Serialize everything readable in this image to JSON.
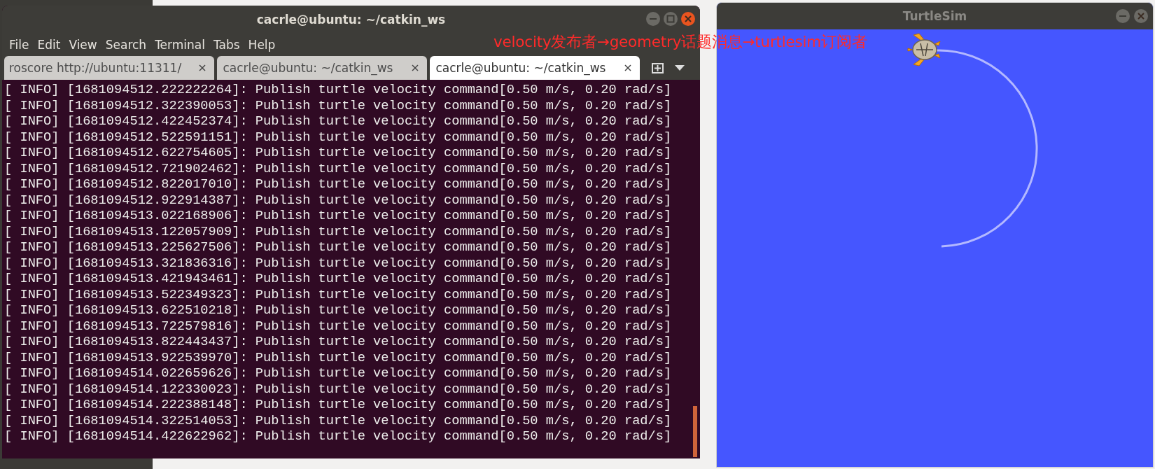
{
  "terminal": {
    "title": "cacrle@ubuntu: ~/catkin_ws",
    "controls": [
      {
        "kind": "minimize"
      },
      {
        "kind": "maximize"
      },
      {
        "kind": "close"
      }
    ],
    "menu": [
      "File",
      "Edit",
      "View",
      "Search",
      "Terminal",
      "Tabs",
      "Help"
    ],
    "tabs": [
      {
        "label": "roscore http://ubuntu:11311/",
        "selected": false
      },
      {
        "label": "cacrle@ubuntu: ~/catkin_ws",
        "selected": false
      },
      {
        "label": "cacrle@ubuntu: ~/catkin_ws",
        "selected": true
      }
    ],
    "lines": [
      "[ INFO] [1681094512.222222264]: Publish turtle velocity command[0.50 m/s, 0.20 rad/s]",
      "[ INFO] [1681094512.322390053]: Publish turtle velocity command[0.50 m/s, 0.20 rad/s]",
      "[ INFO] [1681094512.422452374]: Publish turtle velocity command[0.50 m/s, 0.20 rad/s]",
      "[ INFO] [1681094512.522591151]: Publish turtle velocity command[0.50 m/s, 0.20 rad/s]",
      "[ INFO] [1681094512.622754605]: Publish turtle velocity command[0.50 m/s, 0.20 rad/s]",
      "[ INFO] [1681094512.721902462]: Publish turtle velocity command[0.50 m/s, 0.20 rad/s]",
      "[ INFO] [1681094512.822017010]: Publish turtle velocity command[0.50 m/s, 0.20 rad/s]",
      "[ INFO] [1681094512.922914387]: Publish turtle velocity command[0.50 m/s, 0.20 rad/s]",
      "[ INFO] [1681094513.022168906]: Publish turtle velocity command[0.50 m/s, 0.20 rad/s]",
      "[ INFO] [1681094513.122057909]: Publish turtle velocity command[0.50 m/s, 0.20 rad/s]",
      "[ INFO] [1681094513.225627506]: Publish turtle velocity command[0.50 m/s, 0.20 rad/s]",
      "[ INFO] [1681094513.321836316]: Publish turtle velocity command[0.50 m/s, 0.20 rad/s]",
      "[ INFO] [1681094513.421943461]: Publish turtle velocity command[0.50 m/s, 0.20 rad/s]",
      "[ INFO] [1681094513.522349323]: Publish turtle velocity command[0.50 m/s, 0.20 rad/s]",
      "[ INFO] [1681094513.622510218]: Publish turtle velocity command[0.50 m/s, 0.20 rad/s]",
      "[ INFO] [1681094513.722579816]: Publish turtle velocity command[0.50 m/s, 0.20 rad/s]",
      "[ INFO] [1681094513.822443437]: Publish turtle velocity command[0.50 m/s, 0.20 rad/s]",
      "[ INFO] [1681094513.922539970]: Publish turtle velocity command[0.50 m/s, 0.20 rad/s]",
      "[ INFO] [1681094514.022659626]: Publish turtle velocity command[0.50 m/s, 0.20 rad/s]",
      "[ INFO] [1681094514.122330023]: Publish turtle velocity command[0.50 m/s, 0.20 rad/s]",
      "[ INFO] [1681094514.222388148]: Publish turtle velocity command[0.50 m/s, 0.20 rad/s]",
      "[ INFO] [1681094514.322514053]: Publish turtle velocity command[0.50 m/s, 0.20 rad/s]",
      "[ INFO] [1681094514.422622962]: Publish turtle velocity command[0.50 m/s, 0.20 rad/s]"
    ]
  },
  "turtlesim": {
    "title": "TurtleSim",
    "controls": [
      {
        "kind": "minimize"
      },
      {
        "kind": "close"
      }
    ]
  },
  "annotation": "velocity发布者→geometry话题消息→turtlesim订阅者"
}
